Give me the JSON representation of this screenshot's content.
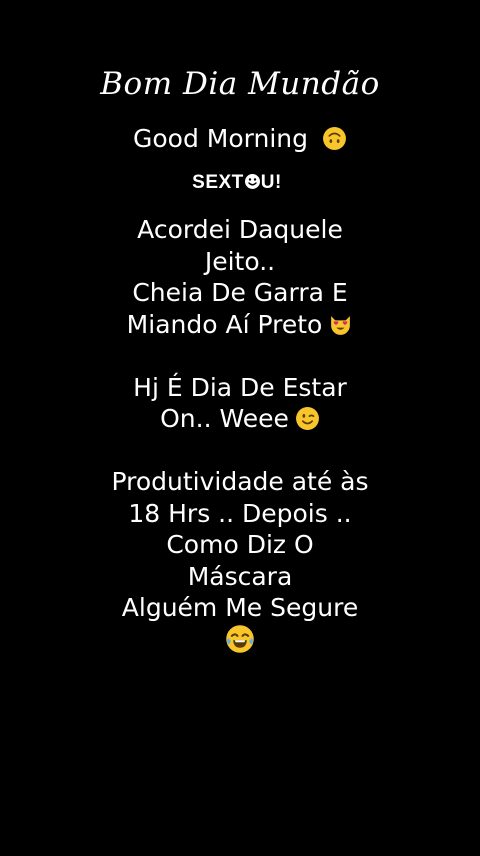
{
  "title": "Bom Dia Mundão",
  "subtitle": "Good Morning",
  "subtitle_emoji": "upside-down-face-icon",
  "tag": {
    "before": "SEXT",
    "after": "U!",
    "o_icon": "smiley-o-icon"
  },
  "paragraphs": [
    {
      "lines": [
        "Acordei Daquele",
        "Jeito..",
        "Cheia De Garra E",
        "Miando Aí Preto"
      ],
      "end_emoji": "heart-eyes-cat-icon"
    },
    {
      "lines": [
        "Hj  É Dia De Estar",
        "On.. Weee"
      ],
      "end_emoji": "winking-face-icon"
    },
    {
      "lines": [
        "Produtividade até às",
        "18 Hrs .. Depois ..",
        "Como Diz O",
        "Máscara",
        "Alguém Me Segure"
      ],
      "end_emoji": "tears-of-joy-icon"
    }
  ],
  "colors": {
    "background": "#000000",
    "text": "#ffffff",
    "emoji_yellow": "#f8c52c"
  }
}
